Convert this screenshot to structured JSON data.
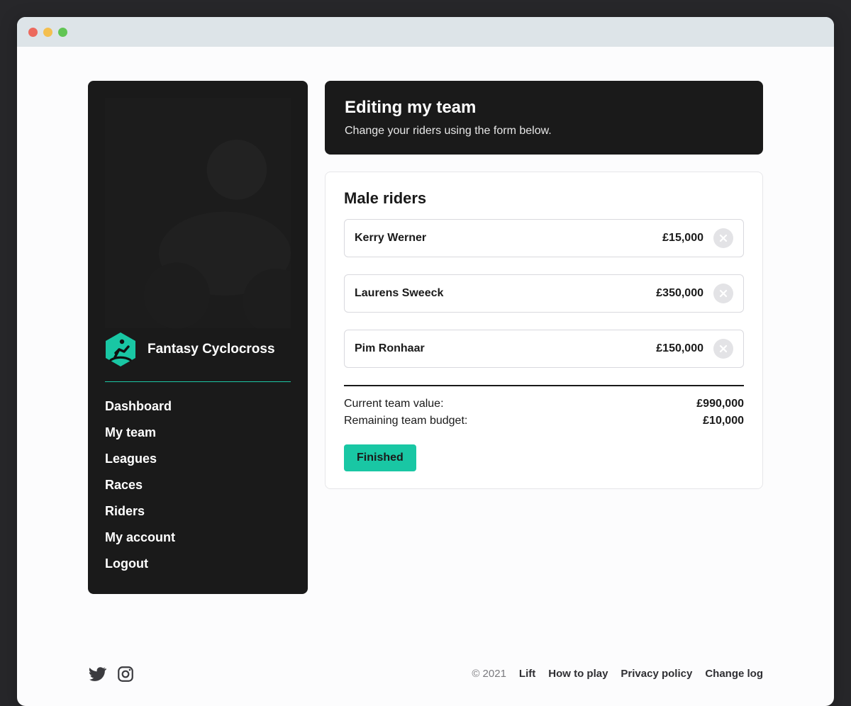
{
  "brand": {
    "name": "Fantasy Cyclocross"
  },
  "sidebar": {
    "items": [
      {
        "label": "Dashboard"
      },
      {
        "label": "My team"
      },
      {
        "label": "Leagues"
      },
      {
        "label": "Races"
      },
      {
        "label": "Riders"
      },
      {
        "label": "My account"
      },
      {
        "label": "Logout"
      }
    ]
  },
  "header": {
    "title": "Editing my team",
    "subtitle": "Change your riders using the form below."
  },
  "editor": {
    "section_title": "Male riders",
    "riders": [
      {
        "name": "Kerry Werner",
        "price": "£15,000"
      },
      {
        "name": "Laurens Sweeck",
        "price": "£350,000"
      },
      {
        "name": "Pim Ronhaar",
        "price": "£150,000"
      }
    ],
    "totals": {
      "current_label": "Current team value:",
      "current_value": "£990,000",
      "remaining_label": "Remaining team budget:",
      "remaining_value": "£10,000"
    },
    "finish_label": "Finished"
  },
  "footer": {
    "copyright": "© 2021",
    "brand_link": "Lift",
    "links": [
      {
        "label": "How to play"
      },
      {
        "label": "Privacy policy"
      },
      {
        "label": "Change log"
      }
    ]
  }
}
